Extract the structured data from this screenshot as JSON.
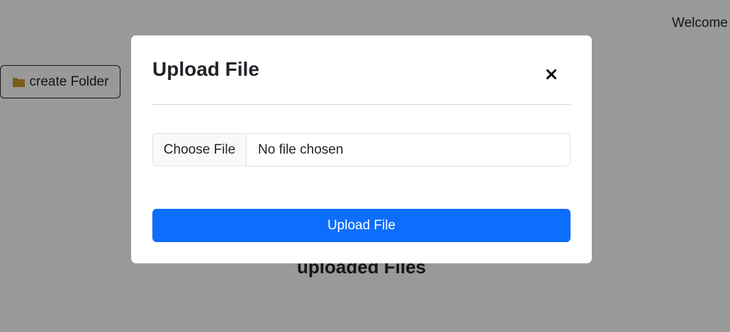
{
  "page": {
    "welcome_text": "Welcome",
    "create_folder_label": "create Folder",
    "uploaded_files_heading": "uploaded Files"
  },
  "modal": {
    "title": "Upload File",
    "close_icon": "close-icon",
    "file_input": {
      "button_label": "Choose File",
      "status": "No file chosen"
    },
    "submit_label": "Upload File"
  },
  "colors": {
    "primary": "#0d6efd",
    "folder_icon": "#c99a2e",
    "backdrop": "rgba(0,0,0,0.4)"
  }
}
